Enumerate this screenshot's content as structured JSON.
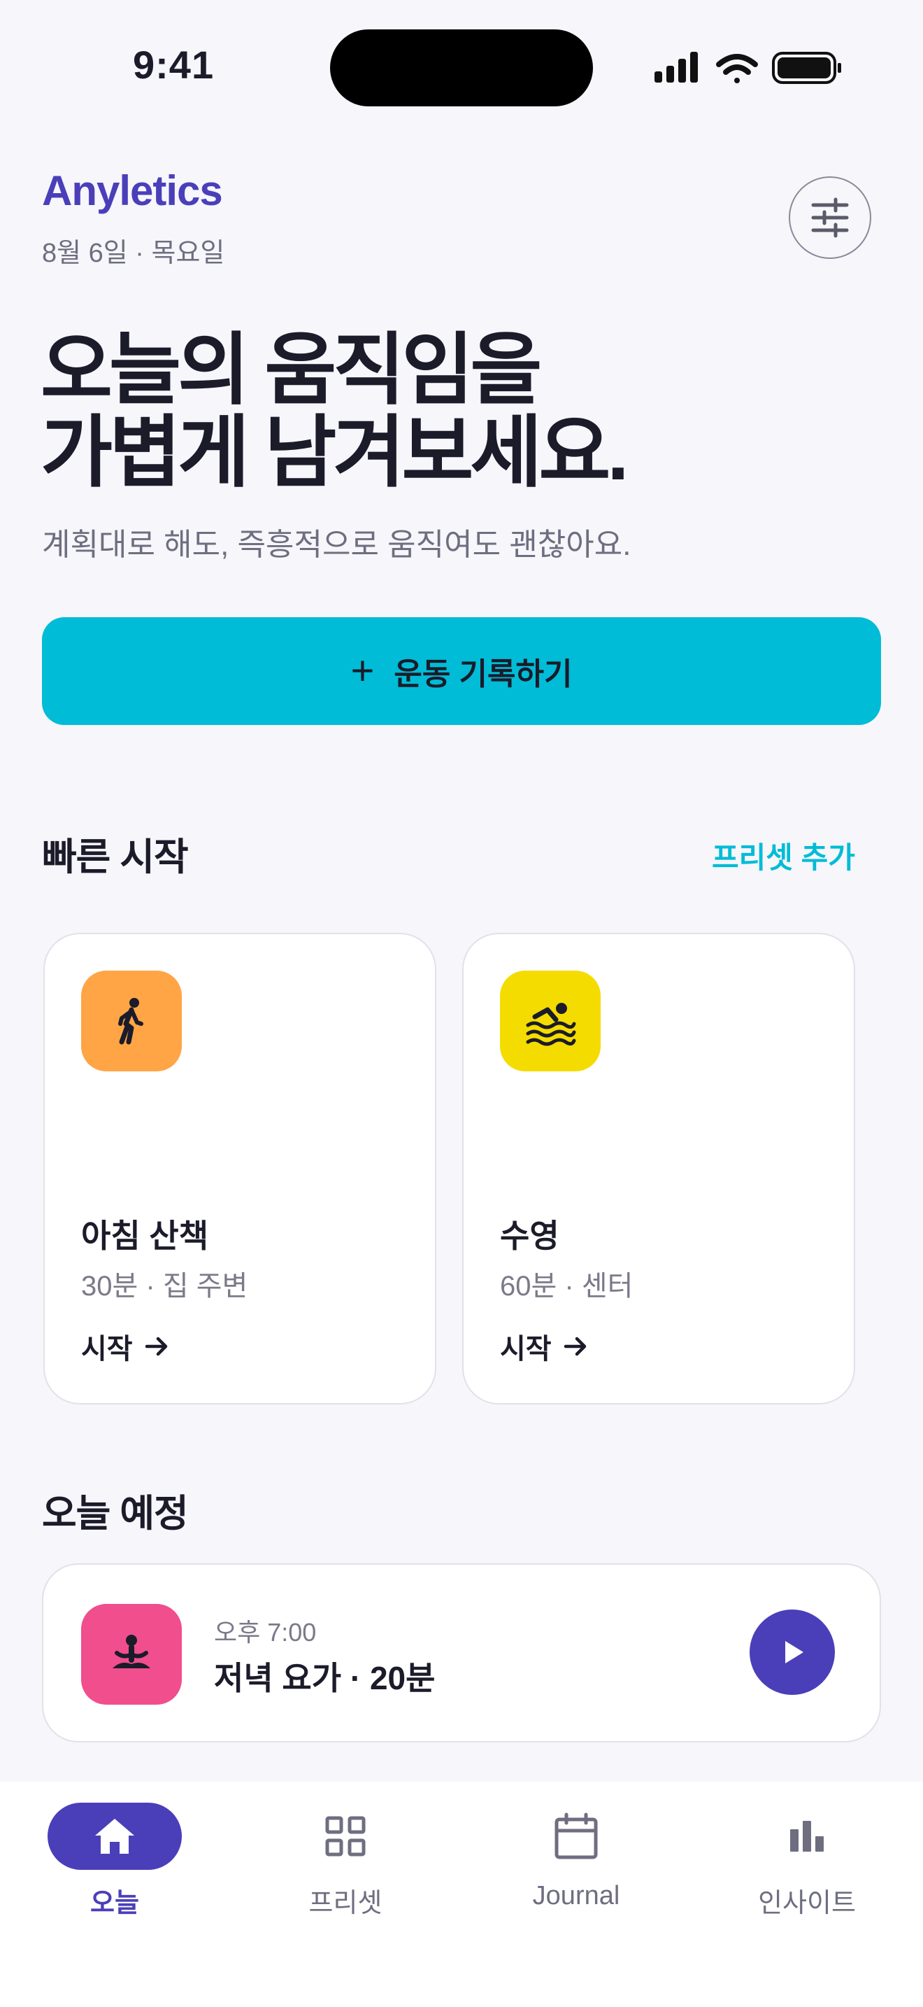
{
  "status_bar": {
    "time": "9:41"
  },
  "header": {
    "logo": "Anyletics",
    "date": "8월 6일 · 목요일",
    "settings_icon": "sliders-icon"
  },
  "hero": {
    "title_line1": "오늘의 움직임을",
    "title_line2": "가볍게 남겨보세요.",
    "subtitle": "계획대로 해도, 즉흥적으로 움직여도 괜찮아요."
  },
  "cta": {
    "plus": "+",
    "label": "운동 기록하기",
    "color": "#00BCD6"
  },
  "quick_start": {
    "title": "빠른 시작",
    "link": "프리셋 추가",
    "cards": [
      {
        "title": "아침 산책",
        "meta": "30분 · 집 주변",
        "start": "시작",
        "icon": "walking-icon",
        "icon_color": "#FFA545"
      },
      {
        "title": "수영",
        "meta": "60분 · 센터",
        "start": "시작",
        "icon": "swimming-icon",
        "icon_color": "#F5DC00"
      }
    ]
  },
  "today_schedule": {
    "title": "오늘 예정",
    "item": {
      "time": "오후 7:00",
      "title": "저녁 요가 · 20분",
      "icon": "yoga-icon",
      "icon_color": "#F04E8D"
    }
  },
  "tabbar": {
    "tabs": [
      {
        "label": "오늘",
        "icon": "home-icon",
        "active": true
      },
      {
        "label": "프리셋",
        "icon": "grid-icon",
        "active": false
      },
      {
        "label": "Journal",
        "icon": "calendar-icon",
        "active": false
      },
      {
        "label": "인사이트",
        "icon": "bar-chart-icon",
        "active": false
      }
    ]
  },
  "colors": {
    "brand": "#4A3FB9",
    "accent": "#00BCD6",
    "background": "#F6F6FB"
  }
}
